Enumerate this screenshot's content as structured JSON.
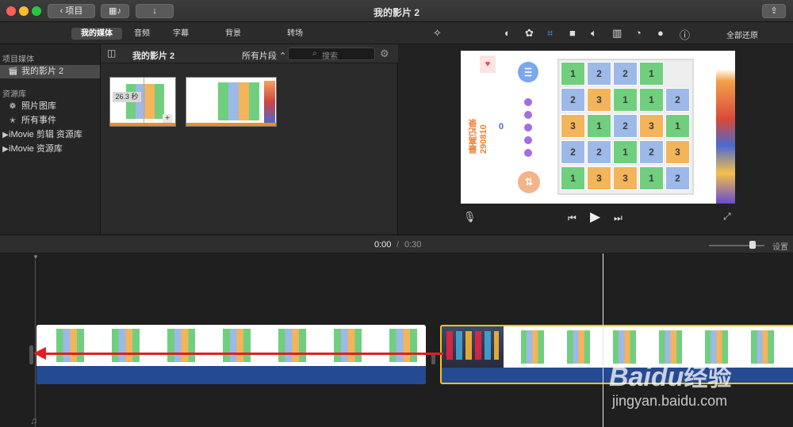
{
  "window": {
    "title": "我的影片 2",
    "back_label": "项目"
  },
  "tabs": [
    "我的媒体",
    "音频",
    "字幕",
    "背景",
    "转场"
  ],
  "toolbar": {
    "reset_label": "全部还原"
  },
  "sidebar": {
    "project_header": "项目媒体",
    "project_item": "我的影片 2",
    "library_header": "资源库",
    "items": [
      "照片图库",
      "所有事件",
      "iMovie 剪辑 资源库",
      "iMovie 资源库"
    ]
  },
  "browser": {
    "title": "我的影片 2",
    "filter": "所有片段",
    "search_placeholder": "搜索",
    "clip_duration": "26.3 秒"
  },
  "preview": {
    "best_label": "最高记录",
    "best_value": "290810",
    "score": "0",
    "grid": [
      [
        "1",
        "2",
        "2",
        "1"
      ],
      [
        "2",
        "3",
        "1",
        "1",
        "2"
      ],
      [
        "3",
        "1",
        "2",
        "3",
        "1"
      ],
      [
        "2",
        "2",
        "1",
        "2",
        "3"
      ],
      [
        "1",
        "3",
        "3",
        "1",
        "2"
      ]
    ]
  },
  "timeline": {
    "current_time": "0:00",
    "separator": "/",
    "total_time": "0:30",
    "settings_label": "设置"
  },
  "watermark": {
    "brand": "Baidu",
    "brand_cn": "经验",
    "url": "jingyan.baidu.com"
  },
  "colors": {
    "green": "#6fcf7e",
    "blue": "#9db9e8",
    "orange": "#f3b45a",
    "select": "#f5c518",
    "audio": "#244a91",
    "accent_red": "#e02020"
  }
}
